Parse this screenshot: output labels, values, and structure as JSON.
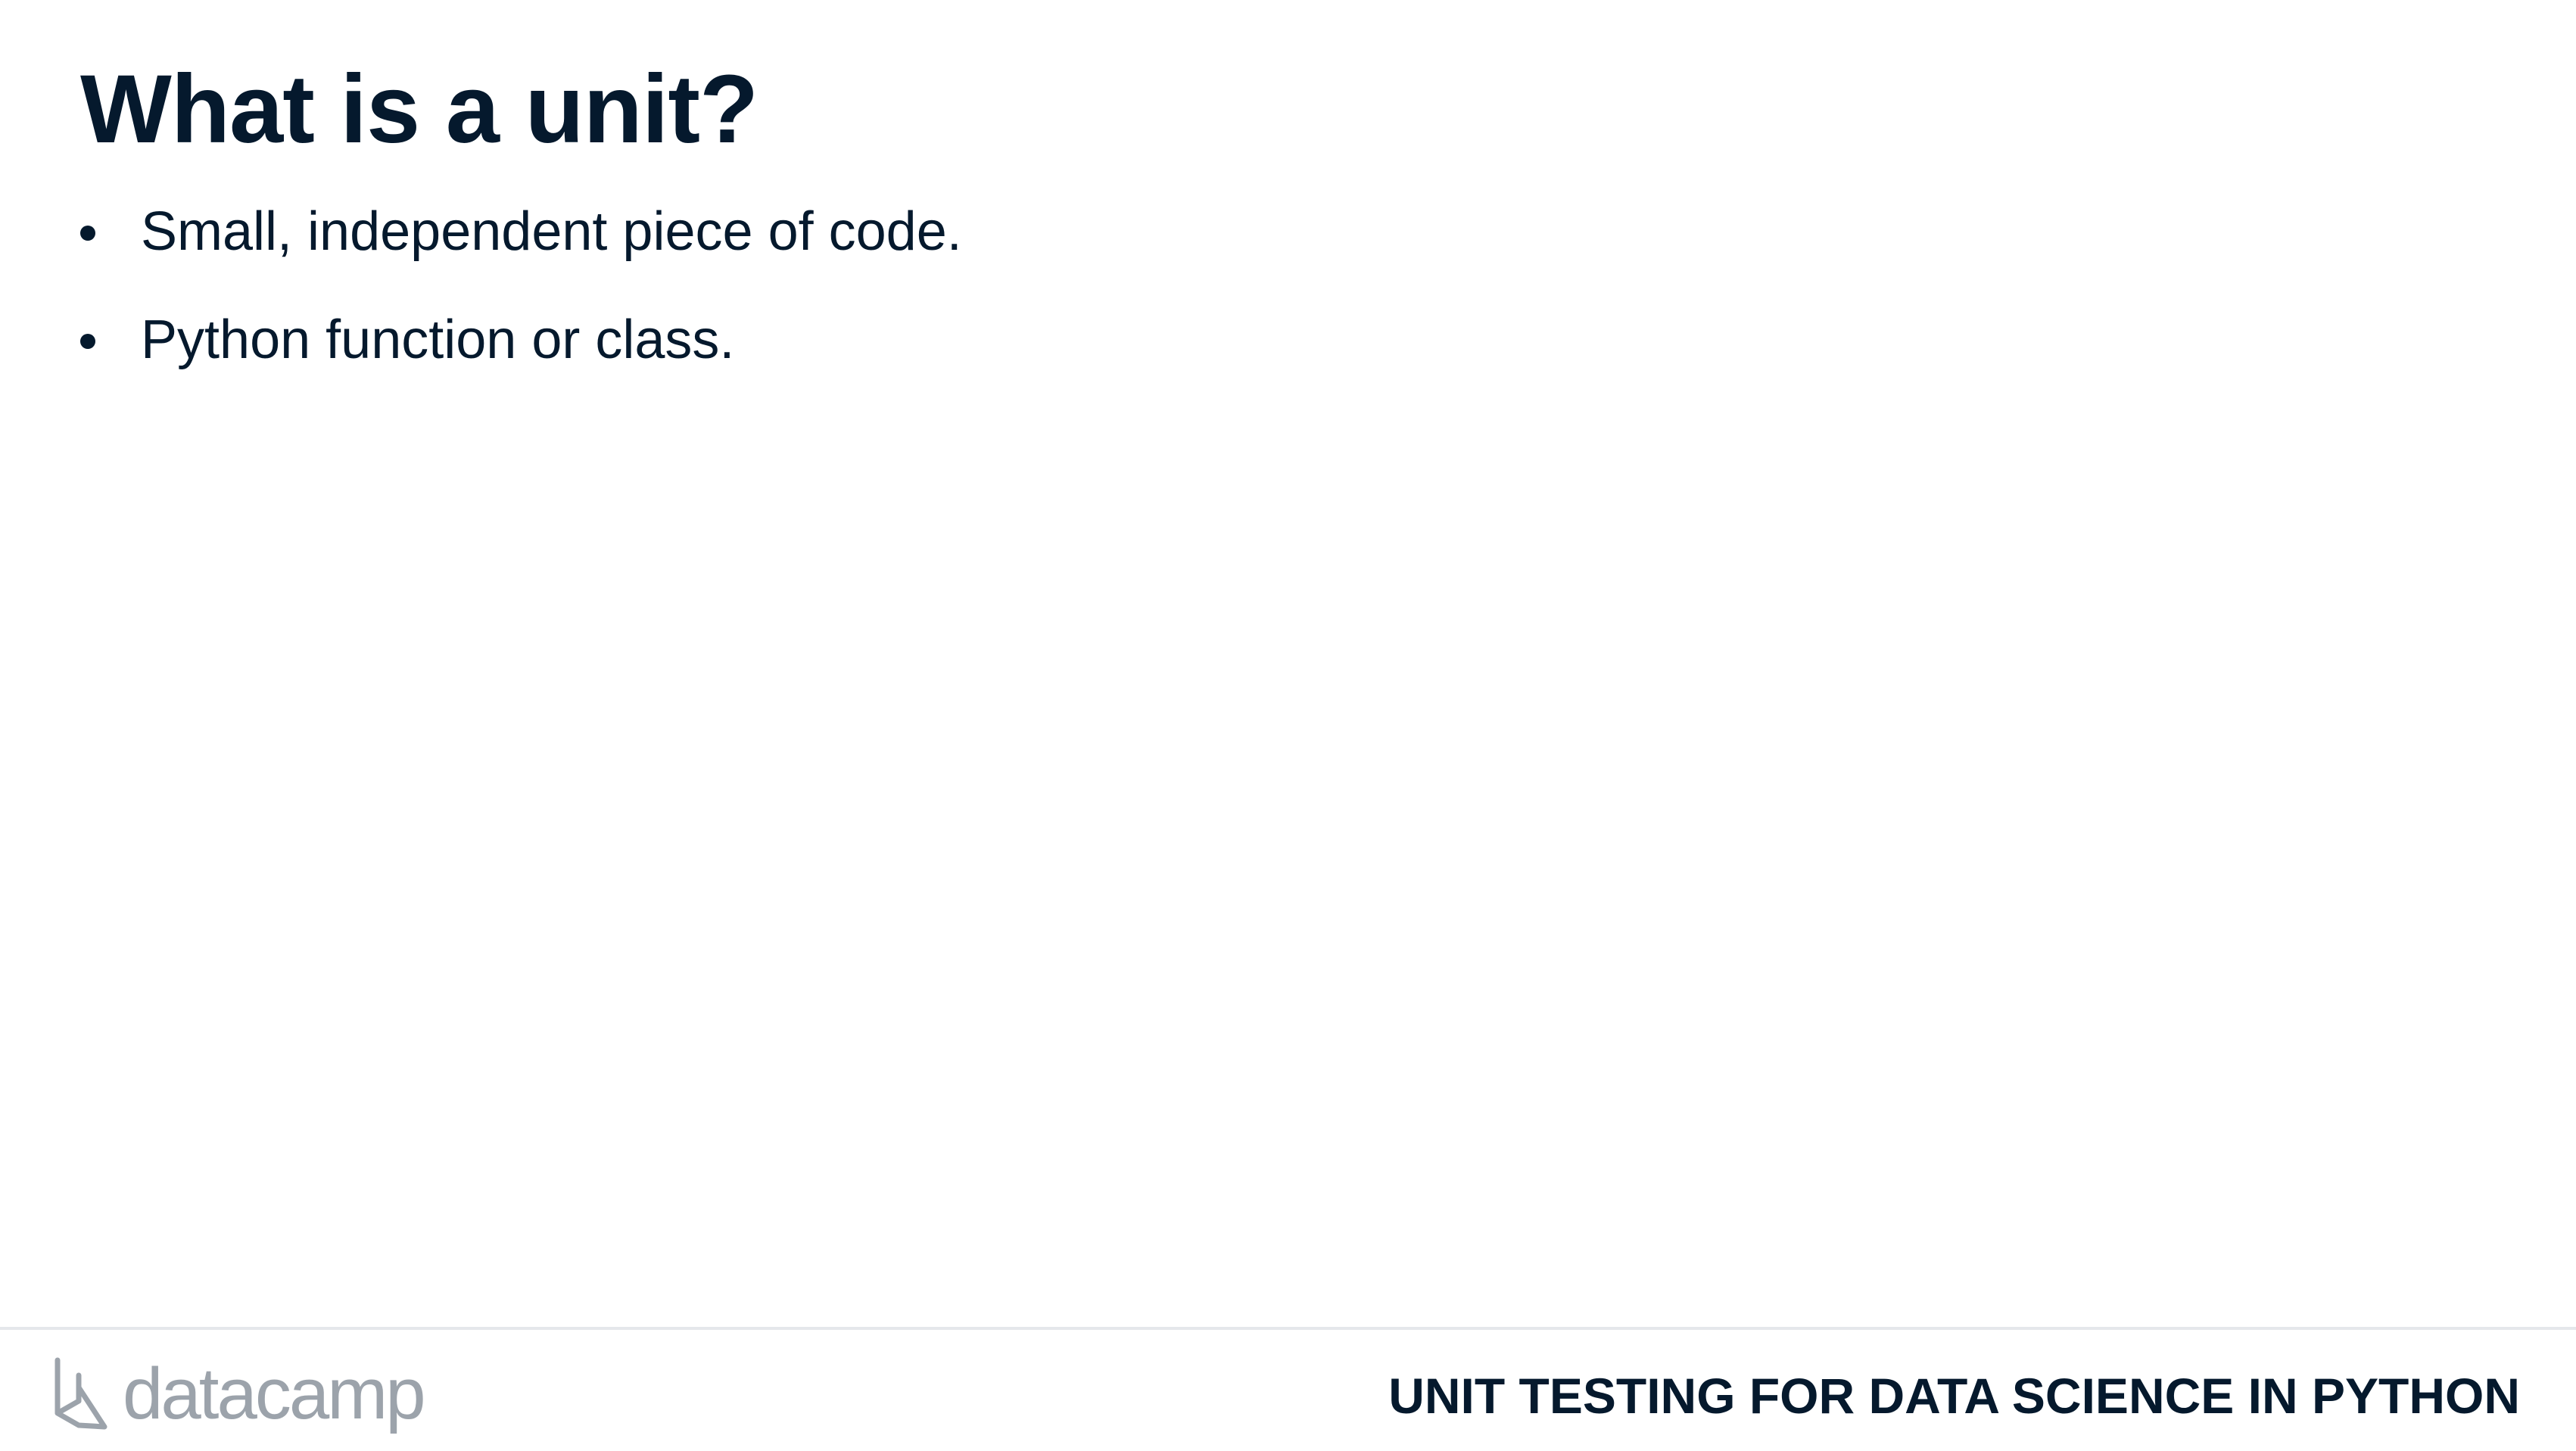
{
  "slide": {
    "title": "What is a unit?",
    "bullets": [
      "Small, independent piece of code.",
      "Python function or class."
    ]
  },
  "footer": {
    "logo_text": "datacamp",
    "logo_icon": "datacamp-logo-icon",
    "course_title": "UNIT TESTING FOR DATA SCIENCE IN PYTHON"
  },
  "colors": {
    "text": "#05192d",
    "logo": "#9ca3ab",
    "divider": "#e5e7eb",
    "background": "#ffffff"
  }
}
